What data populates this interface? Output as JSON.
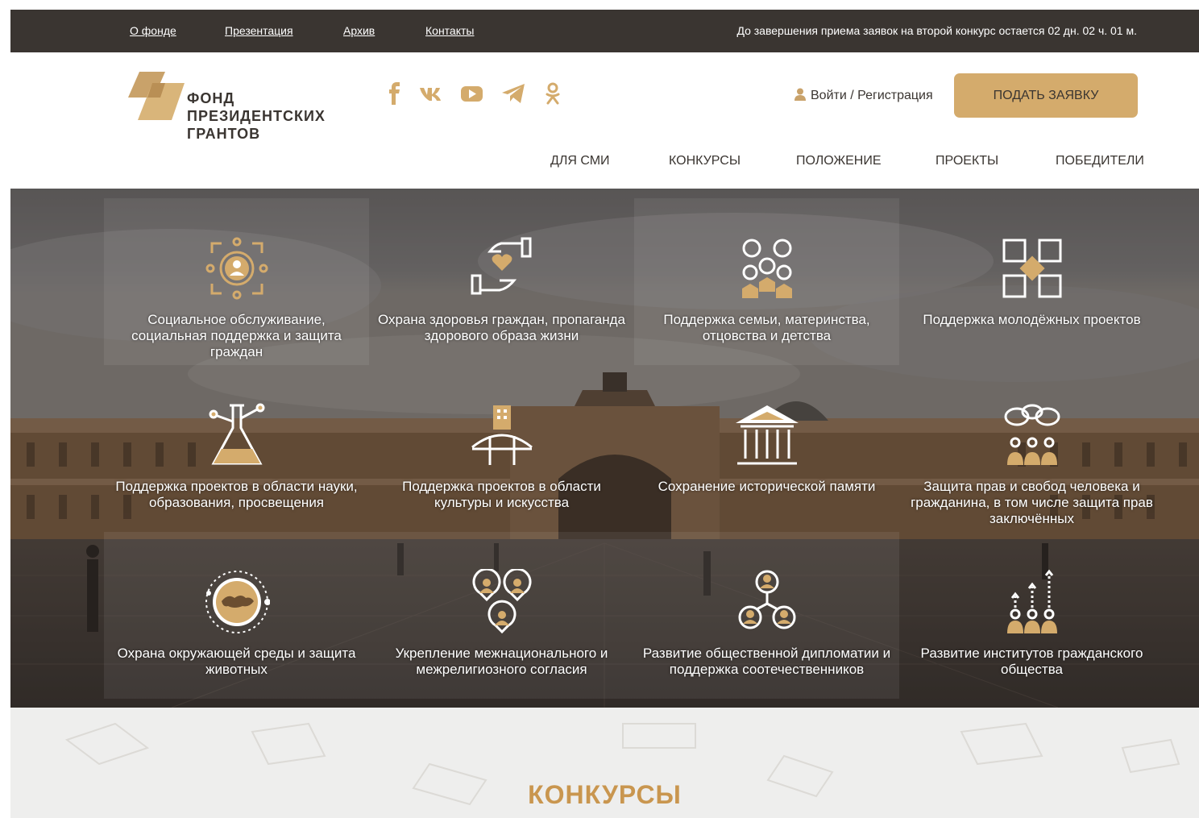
{
  "topbar": {
    "links": [
      "О фонде",
      "Презентация",
      "Архив",
      "Контакты"
    ],
    "countdown": "До завершения приема заявок на второй конкурс остается 02 дн. 02 ч. 01 м."
  },
  "logo": {
    "line1": "ФОНД",
    "line2": "ПРЕЗИДЕНТСКИХ",
    "line3": "ГРАНТОВ"
  },
  "socials": [
    "facebook-icon",
    "vk-icon",
    "youtube-icon",
    "telegram-icon",
    "odnoklassniki-icon"
  ],
  "login": {
    "label": "Войти / Регистрация"
  },
  "apply": {
    "label": "ПОДАТЬ ЗАЯВКУ"
  },
  "nav": [
    "ДЛЯ СМИ",
    "КОНКУРСЫ",
    "ПОЛОЖЕНИЕ",
    "ПРОЕКТЫ",
    "ПОБЕДИТЕЛИ"
  ],
  "grants": [
    {
      "label": "Социальное обслуживание, социальная поддержка и защита граждан",
      "icon": "social-service-icon"
    },
    {
      "label": "Охрана здоровья граждан, пропаганда здорового образа жизни",
      "icon": "health-icon"
    },
    {
      "label": "Поддержка семьи, материнства, отцовства и детства",
      "icon": "family-icon"
    },
    {
      "label": "Поддержка молодёжных проектов",
      "icon": "youth-icon"
    },
    {
      "label": "Поддержка проектов в области науки, образования, просвещения",
      "icon": "science-icon"
    },
    {
      "label": "Поддержка проектов в области культуры и искусства",
      "icon": "culture-icon"
    },
    {
      "label": "Сохранение исторической памяти",
      "icon": "history-icon"
    },
    {
      "label": "Защита прав и свобод человека и гражданина, в том числе защита прав заключённых",
      "icon": "rights-icon"
    },
    {
      "label": "Охрана окружающей среды и защита животных",
      "icon": "environment-icon"
    },
    {
      "label": "Укрепление межнационального и межрелигиозного согласия",
      "icon": "interethnic-icon"
    },
    {
      "label": "Развитие общественной дипломатии и поддержка соотечественников",
      "icon": "diplomacy-icon"
    },
    {
      "label": "Развитие институтов гражданского общества",
      "icon": "civil-society-icon"
    }
  ],
  "section": {
    "title": "КОНКУРСЫ"
  },
  "colors": {
    "accent": "#d4ab6c",
    "dark": "#3a3531",
    "section_title": "#c9964f"
  }
}
